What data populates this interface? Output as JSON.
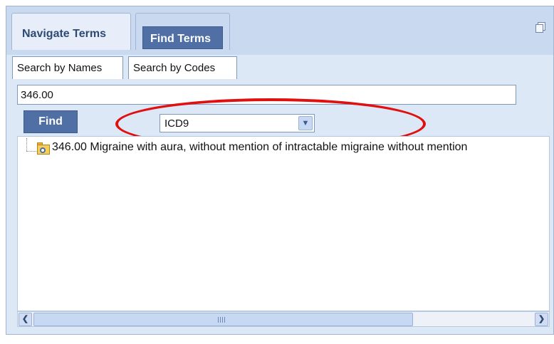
{
  "tabs": {
    "navigate_label": "Navigate Terms",
    "find_label": "Find Terms"
  },
  "subtabs": {
    "names_label": "Search by Names",
    "codes_label": "Search by Codes"
  },
  "search": {
    "value": "346.00"
  },
  "find_button_label": "Find",
  "code_system": {
    "selected": "ICD9"
  },
  "results": [
    {
      "label": "346.00 Migraine with aura, without mention of intractable migraine without mention"
    }
  ],
  "colors": {
    "accent": "#4f6fa5",
    "highlight": "#e01010",
    "panel_bg": "#dde8f6"
  },
  "icons": {
    "restore": "window-restore-icon",
    "folder": "folder-search-icon",
    "dropdown": "chevron-down-icon",
    "scroll_left": "arrow-left-icon",
    "scroll_right": "arrow-right-icon"
  }
}
